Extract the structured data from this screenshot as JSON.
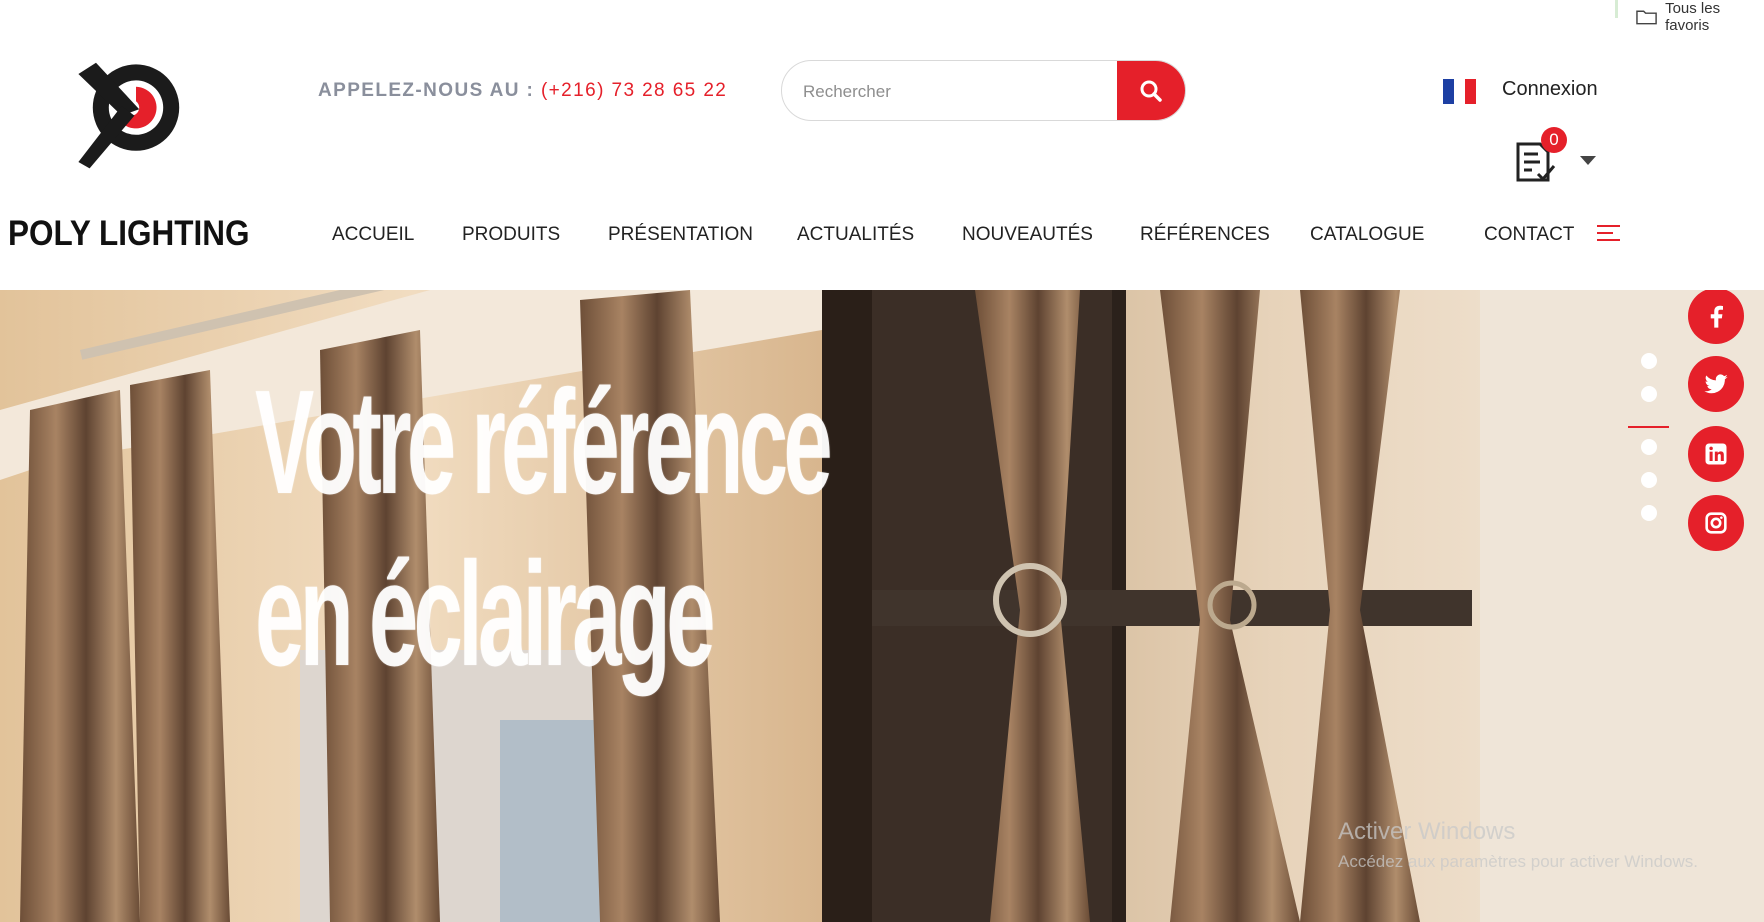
{
  "browser": {
    "favorites_label": "Tous les favoris"
  },
  "brand": {
    "name": "POLY LIGHTING"
  },
  "header": {
    "call_label": "APPELEZ-NOUS AU : ",
    "phone": "(+216) 73 28 65 22",
    "search_placeholder": "Rechercher",
    "login_label": "Connexion",
    "quote_count": "0"
  },
  "nav": {
    "items": [
      "ACCUEIL",
      "PRODUITS",
      "PRÉSENTATION",
      "ACTUALITÉS",
      "NOUVEAUTÉS",
      "RÉFÉRENCES",
      "CATALOGUE",
      "CONTACT"
    ]
  },
  "hero": {
    "line1": "Votre référence",
    "line2": "en éclairage",
    "slides_count": 5,
    "active_slide": 2
  },
  "social": [
    "facebook-icon",
    "twitter-icon",
    "linkedin-icon",
    "instagram-icon"
  ],
  "watermark": {
    "title": "Activer Windows",
    "subtitle": "Accédez aux paramètres pour activer Windows."
  },
  "colors": {
    "accent": "#e5202a",
    "text": "#222222",
    "muted": "#8a8f9c"
  }
}
